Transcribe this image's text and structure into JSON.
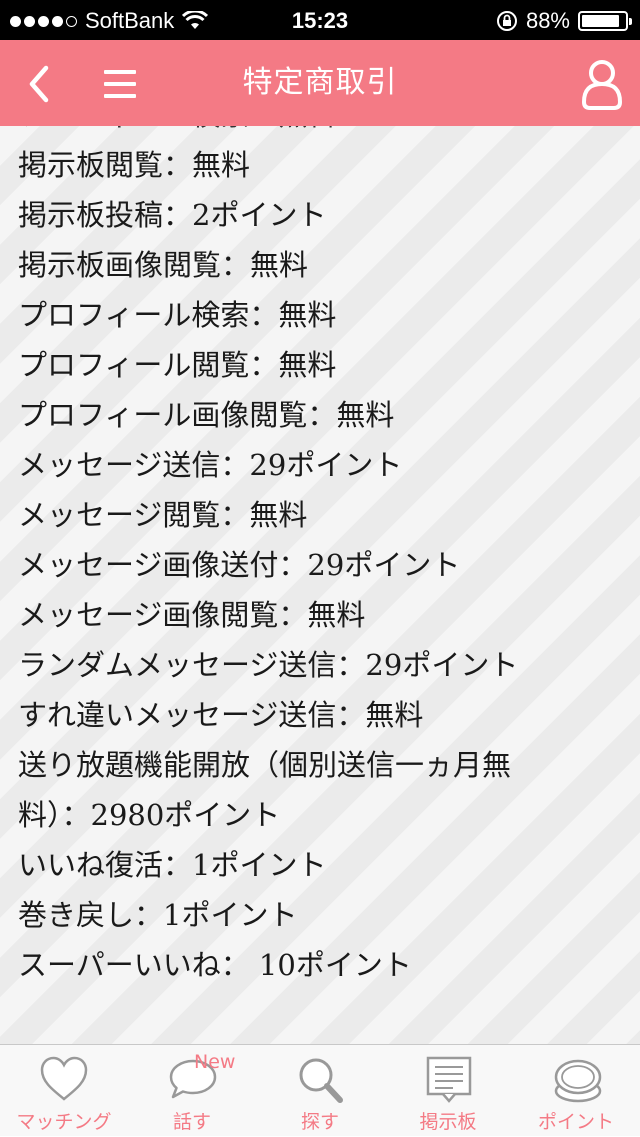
{
  "status_bar": {
    "carrier": "SoftBank",
    "time": "15:23",
    "battery_percent": "88%",
    "battery_level": 0.88,
    "signal_bars_filled": 4,
    "signal_bars_total": 5
  },
  "header": {
    "title": "特定商取引",
    "background_color": "#f47a85",
    "back_icon": "chevron-left-icon",
    "menu_icon": "hamburger-menu-icon",
    "user_icon": "user-icon"
  },
  "price_list": {
    "items": [
      "プロフィール検索：無料",
      "掲示板閲覧：無料",
      "掲示板投稿：2ポイント",
      "掲示板画像閲覧：無料",
      "プロフィール検索：無料",
      "プロフィール閲覧：無料",
      "プロフィール画像閲覧：無料",
      "メッセージ送信：29ポイント",
      "メッセージ閲覧：無料",
      "メッセージ画像送付：29ポイント",
      "メッセージ画像閲覧：無料",
      "ランダムメッセージ送信：29ポイント",
      "すれ違いメッセージ送信：無料",
      "送り放題機能開放（個別送信一ヵ月無",
      "料）：2980ポイント",
      "いいね復活：1ポイント",
      "巻き戻し：1ポイント",
      "スーパーいいね： 10ポイント"
    ]
  },
  "tab_bar": {
    "accent_color": "#f47a85",
    "tabs": [
      {
        "label": "マッチング",
        "icon": "heart-icon"
      },
      {
        "label": "話す",
        "icon": "speech-bubble-icon",
        "badge": "New"
      },
      {
        "label": "探す",
        "icon": "magnifier-icon"
      },
      {
        "label": "掲示板",
        "icon": "bulletin-board-icon"
      },
      {
        "label": "ポイント",
        "icon": "coins-icon"
      }
    ]
  }
}
